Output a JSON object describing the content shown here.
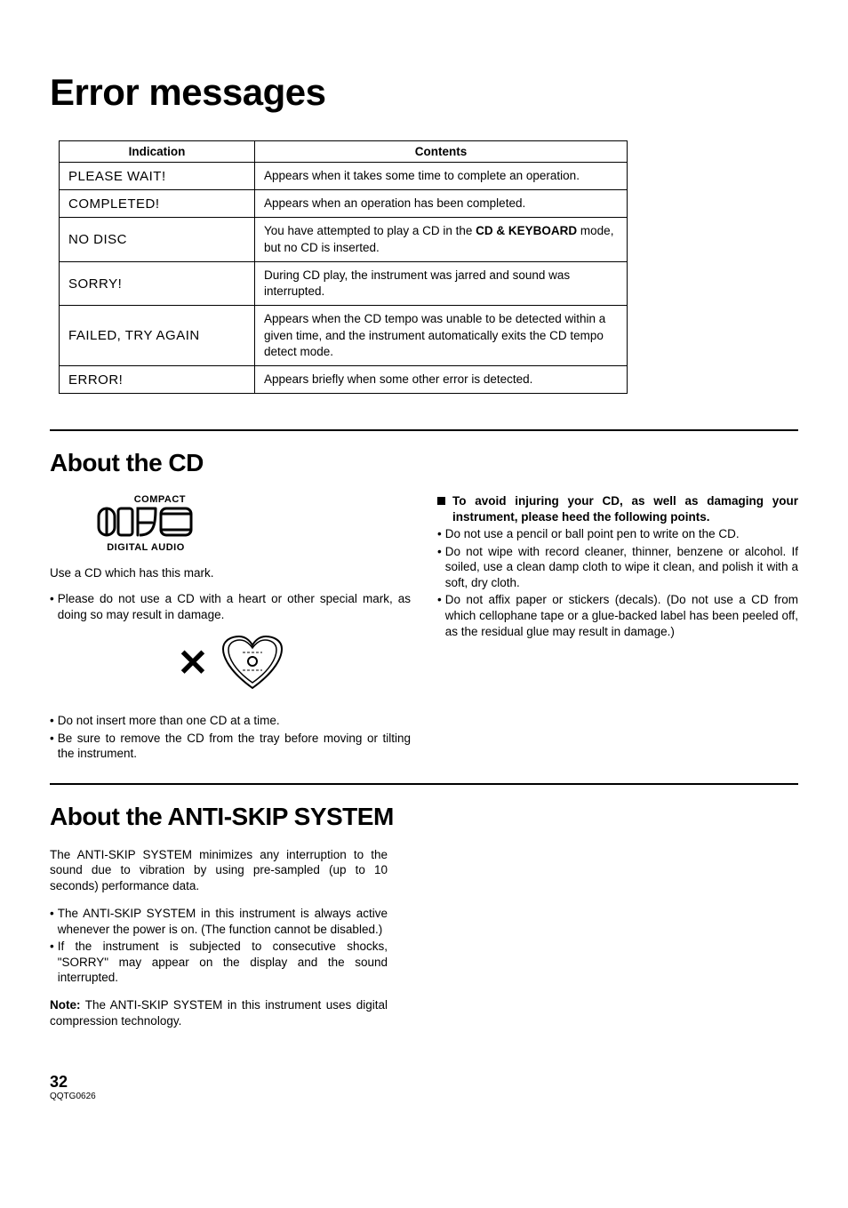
{
  "title_error": "Error messages",
  "table": {
    "header_indication": "Indication",
    "header_contents": "Contents",
    "rows": [
      {
        "ind": "PLEASE WAIT!",
        "cnt": "Appears when it takes some time to complete an operation."
      },
      {
        "ind": "COMPLETED!",
        "cnt": "Appears when an operation has been completed."
      },
      {
        "ind": "NO DISC",
        "cnt_pre": "You have attempted to play a CD in the ",
        "cnt_bold": "CD & KEYBOARD",
        "cnt_post": " mode, but no CD is inserted."
      },
      {
        "ind": "SORRY!",
        "cnt": "During CD play, the instrument was jarred and sound was interrupted."
      },
      {
        "ind": "FAILED, TRY AGAIN",
        "cnt": "Appears when the CD tempo was unable to be detected within a given time, and the instrument automatically exits the CD tempo detect mode."
      },
      {
        "ind": "ERROR!",
        "cnt": "Appears briefly when some other error is detected."
      }
    ]
  },
  "about_cd": {
    "heading": "About the CD",
    "logo_top": "COMPACT",
    "logo_bottom": "DIGITAL AUDIO",
    "use_mark": "Use a CD which has this mark.",
    "left_b1": "Please do not use a CD with a heart or other special mark, as doing so may result in damage.",
    "left_b2": "Do not insert more than one CD at a time.",
    "left_b3": "Be sure to remove the CD from the tray before moving or tilting the instrument.",
    "right_head": "To avoid injuring your CD, as well as damaging your instrument, please heed the following points.",
    "right_b1": "Do not use a pencil or ball point pen to write on the CD.",
    "right_b2": "Do not wipe with record cleaner, thinner, benzene or alcohol. If soiled, use a clean damp cloth to wipe it clean, and polish it with a soft, dry cloth.",
    "right_b3": "Do not affix paper or stickers (decals). (Do not use a CD from which cellophane tape or a glue-backed label has been peeled off, as the residual glue may result in damage.)"
  },
  "anti_skip": {
    "heading": "About the ANTI-SKIP SYSTEM",
    "p1": "The ANTI-SKIP SYSTEM minimizes any interruption to the sound due to vibration by using pre-sampled (up to 10 seconds) performance data.",
    "b1": "The ANTI-SKIP SYSTEM in this instrument is always active whenever the power is on. (The function cannot be disabled.)",
    "b2": "If the instrument is subjected to consecutive shocks, \"SORRY\" may appear on the display and the sound interrupted.",
    "note_label": "Note:",
    "note_text": " The ANTI-SKIP SYSTEM in this instrument uses digital compression technology."
  },
  "footer": {
    "page": "32",
    "doc": "QQTG0626"
  }
}
